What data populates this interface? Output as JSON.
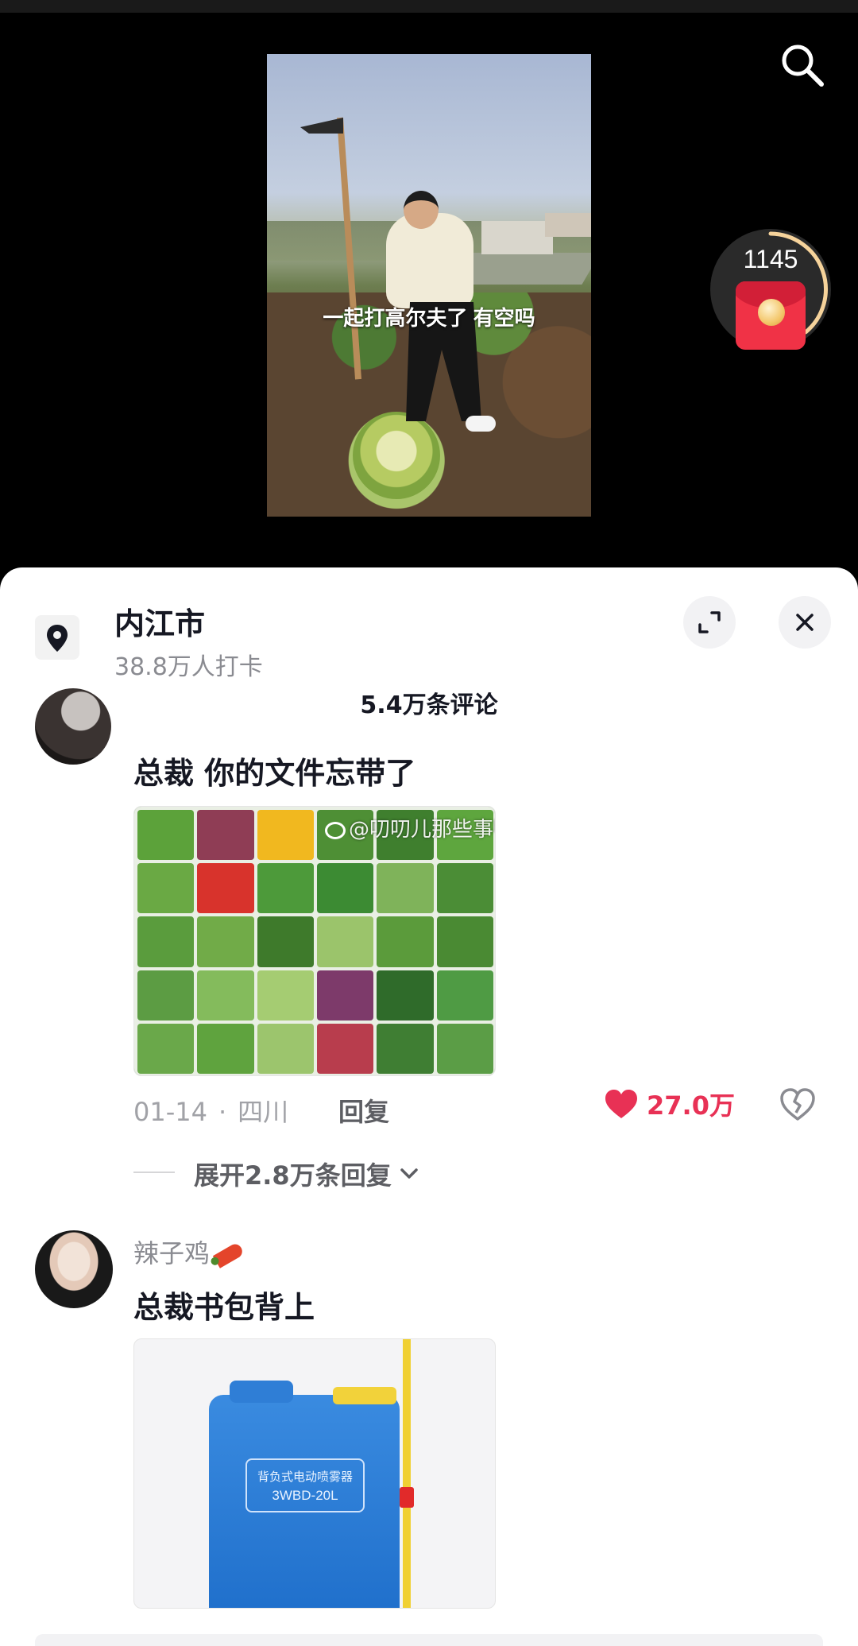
{
  "video": {
    "caption": "一起打高尔夫了 有空吗",
    "red_packet_count": "1145"
  },
  "location": {
    "title": "内江市",
    "checkins": "38.8万人打卡"
  },
  "comments_header": "5.4万条评论",
  "comments": [
    {
      "text": "总裁 你的文件忘带了",
      "image_watermark": "@叨叨儿那些事鸭",
      "date": "01-14",
      "region": "四川",
      "reply_label": "回复",
      "likes": "27.0万",
      "expand_replies": "展开2.8万条回复"
    },
    {
      "username": "辣子鸡",
      "text": "总裁书包背上",
      "image_label_line1": "背负式电动喷雾器",
      "image_label_line2": "3WBD-20L"
    }
  ],
  "icons": {
    "search": "search-icon",
    "location": "location-pin-icon",
    "expand": "expand-icon",
    "close": "close-icon",
    "like": "heart-icon",
    "dislike": "broken-heart-icon",
    "chevron": "chevron-down-icon"
  },
  "colors": {
    "like": "#e83155",
    "red_packet": "#f03246"
  }
}
